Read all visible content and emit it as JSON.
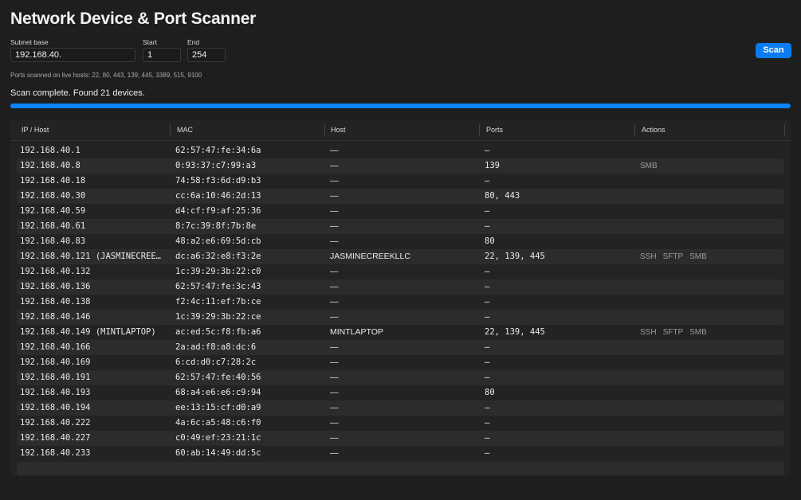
{
  "window": {
    "title": "Network Device & Port Scanner"
  },
  "form": {
    "subnet_label": "Subnet base",
    "subnet_value": "192.168.40.",
    "start_label": "Start",
    "start_value": "1",
    "end_label": "End",
    "end_value": "254",
    "scan_label": "Scan"
  },
  "ports_note": "Ports scanned on live hosts: 22, 80, 443, 139, 445, 3389, 515, 9100",
  "status": "Scan complete. Found 21 devices.",
  "progress": 1.0,
  "colors": {
    "accent": "#0a84ff",
    "button": "#0a7cf0"
  },
  "table": {
    "headers": [
      "IP / Host",
      "MAC",
      "Host",
      "Ports",
      "Actions"
    ],
    "rows": [
      {
        "ip": "192.168.40.1",
        "mac": "62:57:47:fe:34:6a",
        "host": "—",
        "ports": "—",
        "actions": []
      },
      {
        "ip": "192.168.40.8",
        "mac": "0:93:37:c7:99:a3",
        "host": "—",
        "ports": "139",
        "actions": [
          "SMB"
        ]
      },
      {
        "ip": "192.168.40.18",
        "mac": "74:58:f3:6d:d9:b3",
        "host": "—",
        "ports": "—",
        "actions": []
      },
      {
        "ip": "192.168.40.30",
        "mac": "cc:6a:10:46:2d:13",
        "host": "—",
        "ports": "80, 443",
        "actions": []
      },
      {
        "ip": "192.168.40.59",
        "mac": "d4:cf:f9:af:25:36",
        "host": "—",
        "ports": "—",
        "actions": []
      },
      {
        "ip": "192.168.40.61",
        "mac": "8:7c:39:8f:7b:8e",
        "host": "—",
        "ports": "—",
        "actions": []
      },
      {
        "ip": "192.168.40.83",
        "mac": "48:a2:e6:69:5d:cb",
        "host": "—",
        "ports": "80",
        "actions": []
      },
      {
        "ip": "192.168.40.121 (JASMINECREE…",
        "mac": "dc:a6:32:e8:f3:2e",
        "host": "JASMINECREEKLLC",
        "ports": "22, 139, 445",
        "actions": [
          "SSH",
          "SFTP",
          "SMB"
        ]
      },
      {
        "ip": "192.168.40.132",
        "mac": "1c:39:29:3b:22:c0",
        "host": "—",
        "ports": "—",
        "actions": []
      },
      {
        "ip": "192.168.40.136",
        "mac": "62:57:47:fe:3c:43",
        "host": "—",
        "ports": "—",
        "actions": []
      },
      {
        "ip": "192.168.40.138",
        "mac": "f2:4c:11:ef:7b:ce",
        "host": "—",
        "ports": "—",
        "actions": []
      },
      {
        "ip": "192.168.40.146",
        "mac": "1c:39:29:3b:22:ce",
        "host": "—",
        "ports": "—",
        "actions": []
      },
      {
        "ip": "192.168.40.149 (MINTLAPTOP)",
        "mac": "ac:ed:5c:f8:fb:a6",
        "host": "MINTLAPTOP",
        "ports": "22, 139, 445",
        "actions": [
          "SSH",
          "SFTP",
          "SMB"
        ]
      },
      {
        "ip": "192.168.40.166",
        "mac": "2a:ad:f8:a8:dc:6",
        "host": "—",
        "ports": "—",
        "actions": []
      },
      {
        "ip": "192.168.40.169",
        "mac": "6:cd:d0:c7:28:2c",
        "host": "—",
        "ports": "—",
        "actions": []
      },
      {
        "ip": "192.168.40.191",
        "mac": "62:57:47:fe:40:56",
        "host": "—",
        "ports": "—",
        "actions": []
      },
      {
        "ip": "192.168.40.193",
        "mac": "68:a4:e6:e6:c9:94",
        "host": "—",
        "ports": "80",
        "actions": []
      },
      {
        "ip": "192.168.40.194",
        "mac": "ee:13:15:cf:d0:a9",
        "host": "—",
        "ports": "—",
        "actions": []
      },
      {
        "ip": "192.168.40.222",
        "mac": "4a:6c:a5:48:c6:f0",
        "host": "—",
        "ports": "—",
        "actions": []
      },
      {
        "ip": "192.168.40.227",
        "mac": "c0:49:ef:23:21:1c",
        "host": "—",
        "ports": "—",
        "actions": []
      },
      {
        "ip": "192.168.40.233",
        "mac": "60:ab:14:49:dd:5c",
        "host": "—",
        "ports": "—",
        "actions": []
      }
    ]
  }
}
